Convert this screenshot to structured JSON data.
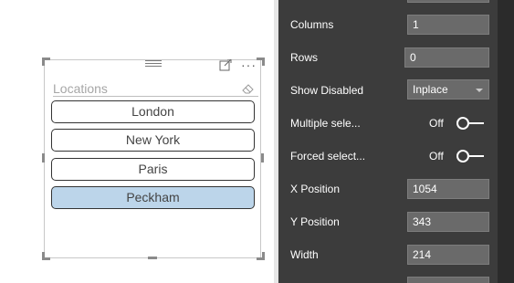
{
  "slicer": {
    "title": "Locations",
    "items": [
      {
        "label": "London",
        "selected": false
      },
      {
        "label": "New York",
        "selected": false
      },
      {
        "label": "Paris",
        "selected": false
      },
      {
        "label": "Peckham",
        "selected": true
      }
    ],
    "icons": [
      "drag-grip-icon",
      "focus-mode-icon",
      "more-options-icon",
      "eraser-icon"
    ],
    "selected_color": "#bcd5ea"
  },
  "format_pane": {
    "columns": {
      "label": "Columns",
      "value": "1"
    },
    "rows": {
      "label": "Rows",
      "value": "0"
    },
    "show_disabled": {
      "label": "Show Disabled",
      "value": "Inplace"
    },
    "multiple_select": {
      "label": "Multiple sele...",
      "state": "Off"
    },
    "forced_select": {
      "label": "Forced select...",
      "state": "Off"
    },
    "x_position": {
      "label": "X Position",
      "value": "1054"
    },
    "y_position": {
      "label": "Y Position",
      "value": "343"
    },
    "width": {
      "label": "Width",
      "value": "214"
    },
    "background_color": "#3c3c3c"
  }
}
